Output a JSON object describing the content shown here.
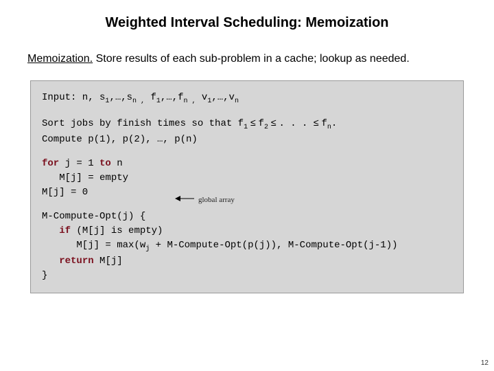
{
  "title": "Weighted Interval Scheduling:  Memoization",
  "lead": "Memoization.",
  "body": "  Store results of each sub-problem in a cache; lookup as needed.",
  "code": {
    "input_prefix": "Input: n, s",
    "input_seq1_sub1": "1",
    "input_seq1_mid": ",…,s",
    "input_seq1_subn": "n ,",
    "input_seq1_mid2": " f",
    "input_seq1_subf1": "1",
    "input_seq1_mid3": ",…,f",
    "input_seq1_subfn": "n ,",
    "input_seq1_mid4": " v",
    "input_seq1_subv1": "1",
    "input_seq1_mid5": ",…,v",
    "input_seq1_subvn": "n",
    "sort_prefix": "Sort jobs by finish times so that f",
    "sort_sub1": "1",
    "sort_le1": " ≤ ",
    "sort_mid1": "f",
    "sort_sub2": "2",
    "sort_le2": " ≤ ",
    "sort_dots": ". . . ",
    "sort_le3": "≤ ",
    "sort_mid2": "f",
    "sort_subn": "n",
    "sort_end": ".",
    "compute_line": "Compute p(1), p(2), …, p(n)",
    "for_kw": "for",
    "for_rest": " j = 1 ",
    "to_kw": "to",
    "for_rest2": " n",
    "mj_empty": "   M[j] = empty",
    "mj_zero": "M[j] = 0",
    "fn_open": "M-Compute-Opt(j) {",
    "if_kw": "if",
    "if_rest": " (M[j] is empty)",
    "assign_pre": "      M[j] = max(w",
    "assign_subj": "j",
    "assign_rest": " + M-Compute-Opt(p(j)), M-Compute-Opt(j-1))",
    "return_kw": "return",
    "return_rest": " M[j]",
    "fn_close": "}"
  },
  "annotation": "global array",
  "pagenum": "12"
}
